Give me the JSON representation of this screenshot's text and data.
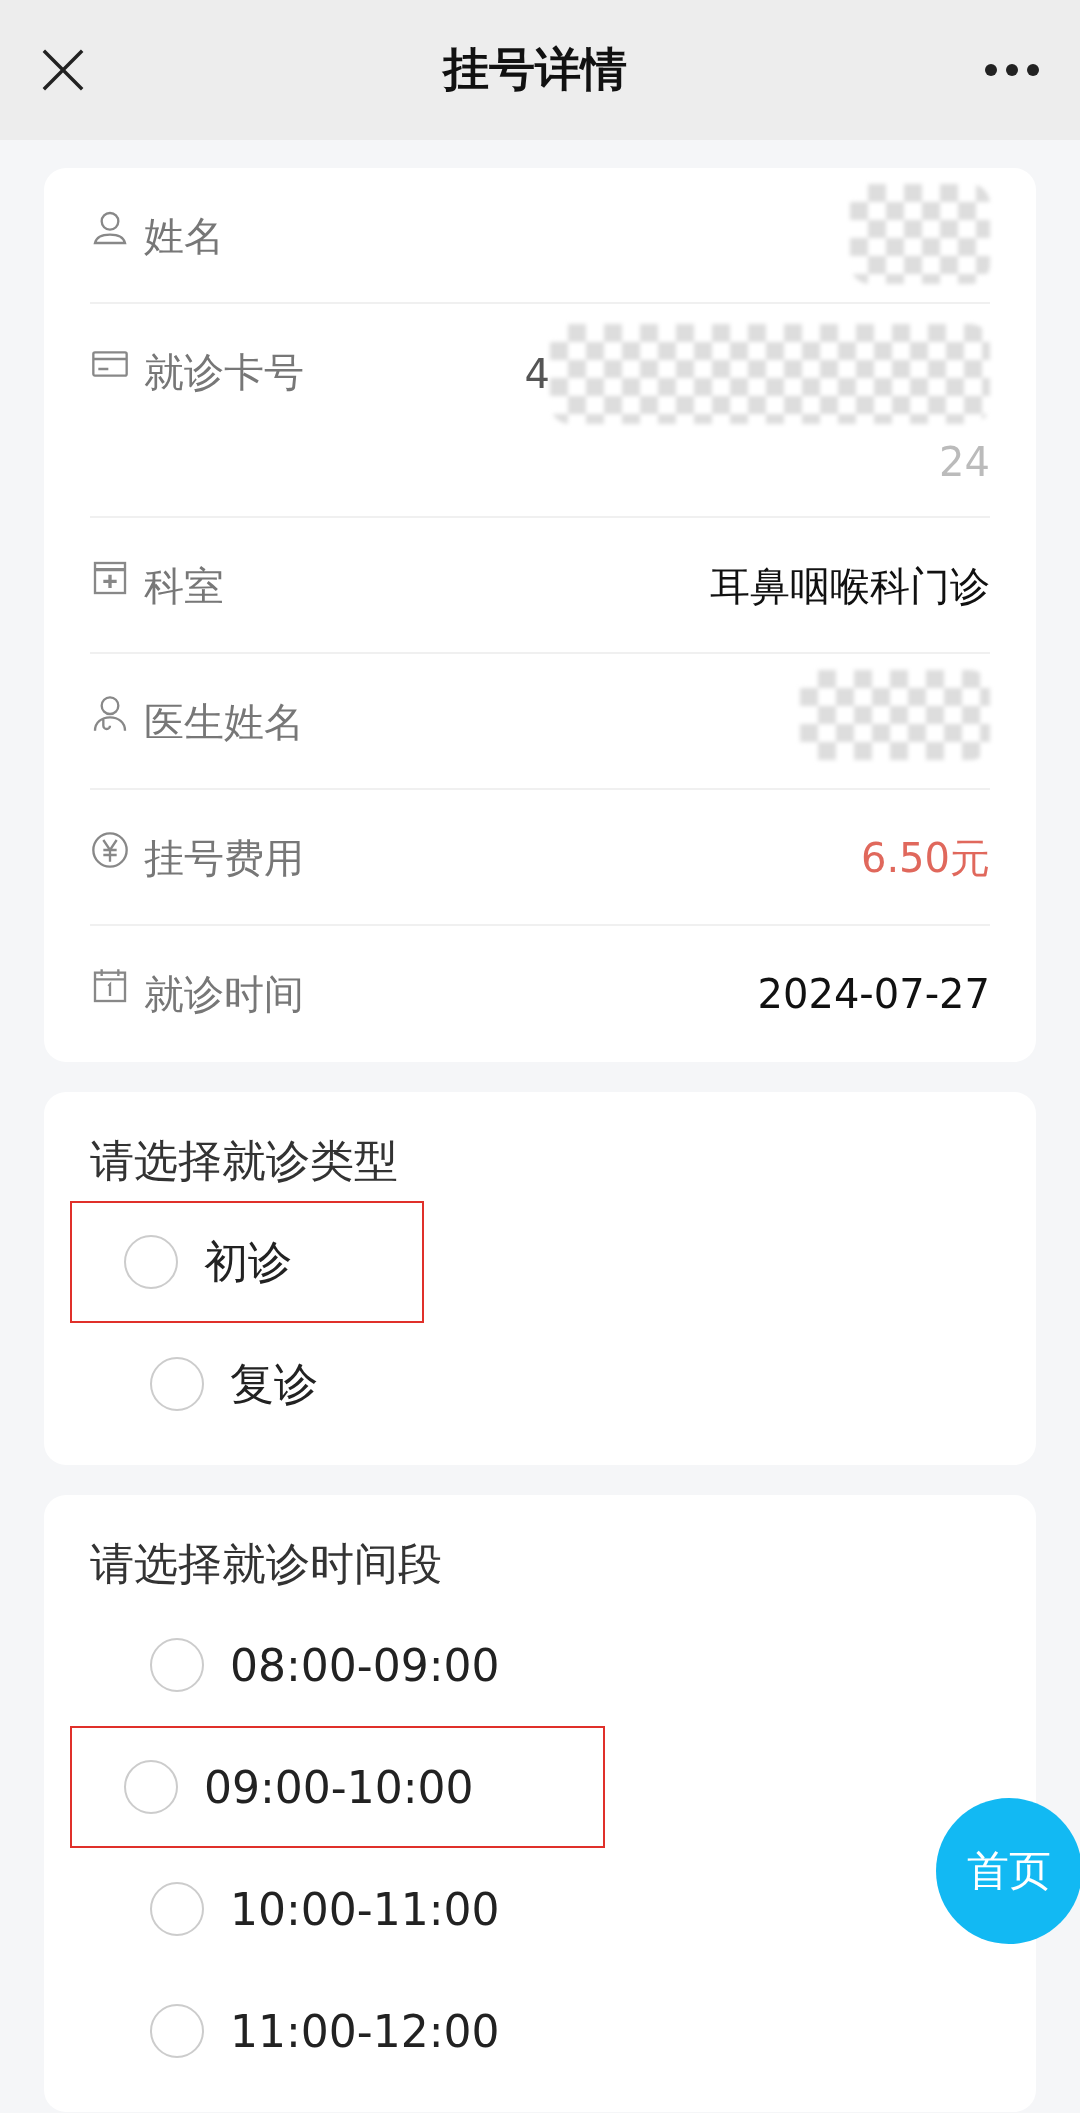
{
  "header": {
    "title": "挂号详情"
  },
  "details": [
    {
      "kind": "person",
      "label": "姓名",
      "redacted": true
    },
    {
      "kind": "card",
      "label": "就诊卡号",
      "redacted": true,
      "fragments": [
        "4",
        "24"
      ]
    },
    {
      "kind": "department",
      "label": "科室",
      "value": "耳鼻咽喉科门诊"
    },
    {
      "kind": "doctor",
      "label": "医生姓名",
      "redacted": true
    },
    {
      "kind": "fee",
      "label": "挂号费用",
      "value": "6.50元"
    },
    {
      "kind": "calendar",
      "label": "就诊时间",
      "value": "2024-07-27"
    }
  ],
  "visit_type": {
    "title": "请选择就诊类型",
    "options": [
      {
        "label": "初诊",
        "selected": false,
        "highlighted": true
      },
      {
        "label": "复诊",
        "selected": false,
        "highlighted": false
      }
    ]
  },
  "time_slot": {
    "title": "请选择就诊时间段",
    "options": [
      {
        "label": "08:00-09:00",
        "selected": false,
        "highlighted": false
      },
      {
        "label": "09:00-10:00",
        "selected": false,
        "highlighted": true
      },
      {
        "label": "10:00-11:00",
        "selected": false,
        "highlighted": false
      },
      {
        "label": "11:00-12:00",
        "selected": false,
        "highlighted": false
      }
    ]
  },
  "home_button": "首页"
}
